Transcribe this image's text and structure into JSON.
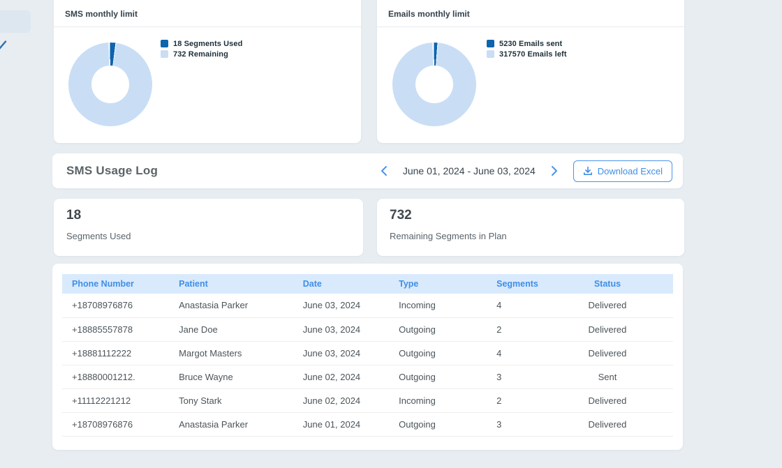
{
  "colors": {
    "accent_blue": "#3f8ee8",
    "dark_blue": "#0e64ad",
    "light_blue": "#c9def5",
    "table_header_bg": "#d9eafc",
    "page_bg": "#e8edf1"
  },
  "icons": {
    "sidebar_check": "checkmark",
    "prev": "chevron-left",
    "next": "chevron-right",
    "download": "download-arrow-tray"
  },
  "cards": {
    "sms_limit": {
      "title": "SMS monthly limit",
      "donut": {
        "segments": [
          {
            "label": "18 Segments Used",
            "value": 18,
            "color": "#0e64ad"
          },
          {
            "label": "732 Remaining",
            "value": 732,
            "color": "#c9def5"
          }
        ]
      }
    },
    "emails_limit": {
      "title": "Emails monthly limit",
      "donut": {
        "segments": [
          {
            "label": "5230 Emails sent",
            "value": 5230,
            "color": "#0e64ad"
          },
          {
            "label": "317570 Emails left",
            "value": 317570,
            "color": "#c9def5"
          }
        ]
      }
    }
  },
  "usage_log": {
    "title": "SMS Usage Log",
    "date_range": "June 01, 2024 - June 03, 2024",
    "download_label": "Download Excel"
  },
  "stats": [
    {
      "value": "18",
      "label": "Segments Used"
    },
    {
      "value": "732",
      "label": "Remaining Segments in Plan"
    }
  ],
  "table": {
    "columns": [
      "Phone Number",
      "Patient",
      "Date",
      "Type",
      "Segments",
      "Status"
    ],
    "rows": [
      [
        "+18708976876",
        "Anastasia Parker",
        "June 03, 2024",
        "Incoming",
        "4",
        "Delivered"
      ],
      [
        "+18885557878",
        "Jane Doe",
        "June 03, 2024",
        "Outgoing",
        "2",
        "Delivered"
      ],
      [
        "+18881112222",
        "Margot Masters",
        "June 03, 2024",
        "Outgoing",
        "4",
        "Delivered"
      ],
      [
        "+18880001212.",
        "Bruce Wayne",
        "June 02, 2024",
        "Outgoing",
        "3",
        "Sent"
      ],
      [
        "+11112221212",
        "Tony Stark",
        "June 02, 2024",
        "Incoming",
        "2",
        "Delivered"
      ],
      [
        "+18708976876",
        "Anastasia Parker",
        "June 01, 2024",
        "Outgoing",
        "3",
        "Delivered"
      ]
    ]
  },
  "chart_data": [
    {
      "type": "pie",
      "title": "SMS monthly limit",
      "labels": [
        "Segments Used",
        "Remaining"
      ],
      "values": [
        18,
        732
      ],
      "colors": [
        "#0e64ad",
        "#c9def5"
      ],
      "legend_position": "right",
      "donut": true
    },
    {
      "type": "pie",
      "title": "Emails monthly limit",
      "labels": [
        "Emails sent",
        "Emails left"
      ],
      "values": [
        5230,
        317570
      ],
      "colors": [
        "#0e64ad",
        "#c9def5"
      ],
      "legend_position": "right",
      "donut": true
    }
  ]
}
